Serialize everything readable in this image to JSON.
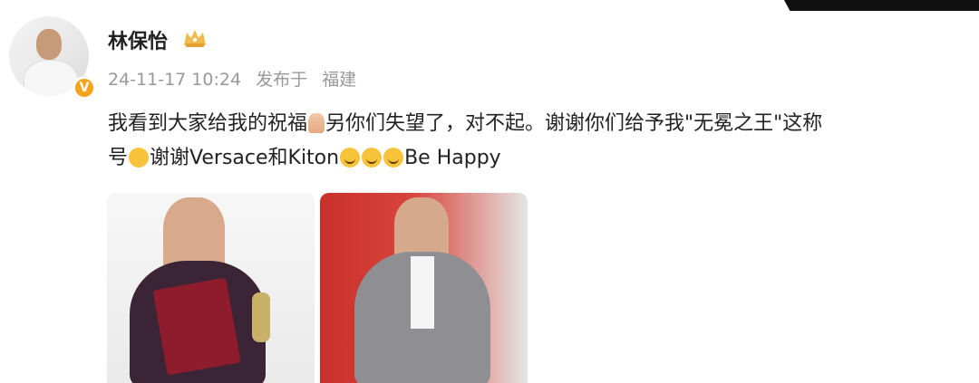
{
  "post": {
    "username": "林保怡",
    "verified_mark": "V",
    "time": "24-11-17 10:24",
    "published_in": "发布于",
    "location": "福建",
    "line1": "我看到大家给我的祝福",
    "line2": "另你们失望了，对不起。谢谢你们给予我\"无冕之王\"这称",
    "line3": "号",
    "line4": "谢谢Versace和Kiton",
    "line5": "Be Happy"
  },
  "emojis": {
    "pray": "pray-emoji",
    "kiss": "kiss-emoji",
    "smile": "smile-emoji"
  },
  "colors": {
    "accent": "#f7a21b",
    "meta": "#999999",
    "text": "#222222"
  }
}
